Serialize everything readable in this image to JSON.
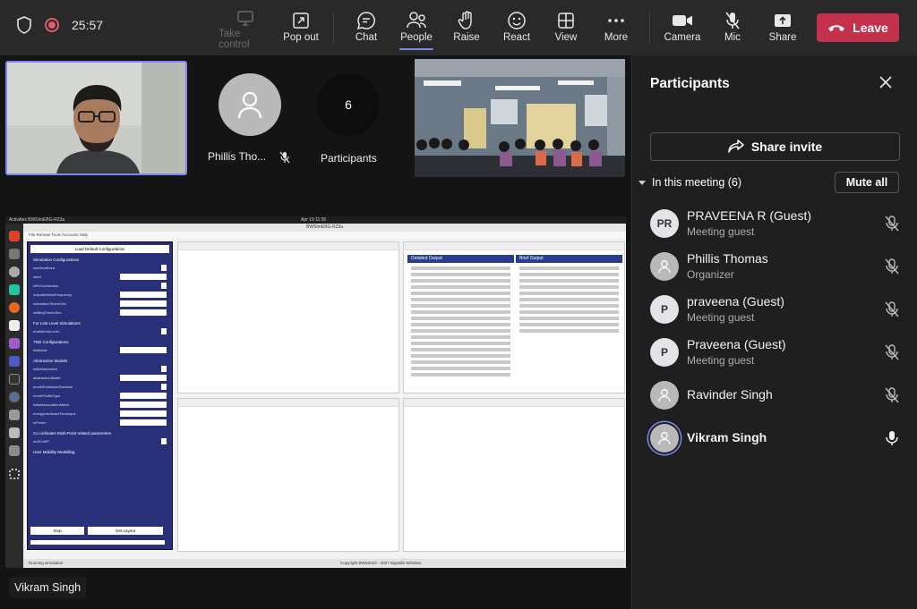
{
  "top_bar": {
    "timer": "25:57",
    "buttons": {
      "take_control": "Take control",
      "pop_out": "Pop out",
      "chat": "Chat",
      "people": "People",
      "raise": "Raise",
      "react": "React",
      "view": "View",
      "more": "More",
      "camera": "Camera",
      "mic": "Mic",
      "share": "Share"
    },
    "leave_label": "Leave"
  },
  "stage": {
    "tiles": {
      "phillis_name": "Phillis Tho...",
      "participants_count": "6",
      "participants_label": "Participants"
    },
    "shared_screen": {
      "topbar_left": "Activities   BWSImEBG-R23a",
      "topbar_clock": "Apr 19  11:55",
      "window_title": "BWSImEBG-R23a",
      "menu": "File    Remote    Tools    Accounts    Help",
      "load_button": "Load Default Configurations",
      "section_sim": "Simulation Configurations",
      "section_link": "For Link Level Simulations",
      "section_tdd": "TDD Configurations",
      "section_abstraction": "Abstraction Models",
      "section_coords": "Co-ordinates Multi-Point related parameters",
      "section_mobility": "User Mobility Modelling",
      "stop_button": "Stop",
      "get_layout_button": "Get Layout",
      "detailed_output": "Detailed Output",
      "brief_output": "Brief Output",
      "status_text": "Running simulation",
      "copyright": "Copyright BWS2023 - 2027 Bignalla Wireless"
    },
    "speaker_label": "Vikram Singh"
  },
  "participants_panel": {
    "title": "Participants",
    "share_invite": "Share invite",
    "in_meeting": "In this meeting (6)",
    "mute_all": "Mute all",
    "people": [
      {
        "name": "PRAVEENA R (Guest)",
        "role": "Meeting guest",
        "initials": "PR"
      },
      {
        "name": "Phillis Thomas",
        "role": "Organizer",
        "initials": ""
      },
      {
        "name": "praveena (Guest)",
        "role": "Meeting guest",
        "initials": "P"
      },
      {
        "name": "Praveena (Guest)",
        "role": "Meeting guest",
        "initials": "P"
      },
      {
        "name": "Ravinder Singh",
        "role": "",
        "initials": ""
      },
      {
        "name": "Vikram Singh",
        "role": "",
        "initials": ""
      }
    ]
  },
  "colors": {
    "accent": "#7f85f5",
    "leave": "#c4314b",
    "recording": "#e05c6b",
    "app_panel": "#2a2f7a"
  }
}
